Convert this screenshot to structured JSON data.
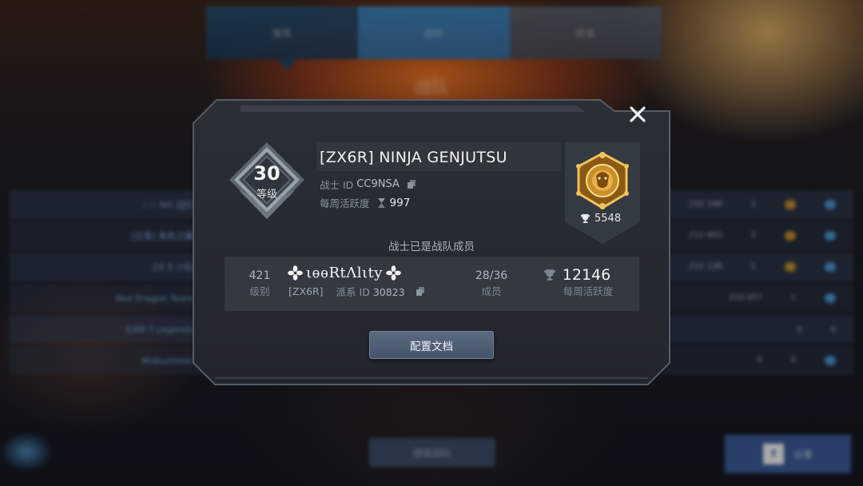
{
  "background": {
    "tabs": [
      "推荐",
      "组织",
      "好友"
    ],
    "heading": "战队",
    "rows": [
      {
        "name": "☆☆ NG 战队",
        "score": "232 168",
        "count": "1"
      },
      {
        "name": "[日落] 黑色之翼",
        "score": "212 902",
        "count": "2"
      },
      {
        "name": "ZX 9 小队",
        "score": "212 138",
        "count": "1"
      },
      {
        "name": "Red Dragon Team",
        "score": "210 457",
        "count": "1"
      },
      {
        "name": "EXM 7 Legends",
        "score": "0",
        "count": "0"
      },
      {
        "name": "Midsummer",
        "score": "0",
        "count": "0"
      }
    ],
    "bottom_button_label": "搜索战队",
    "fb_button_label": "分享"
  },
  "profile": {
    "rank": {
      "number": "30",
      "label": "等级"
    },
    "player_name": "[ZX6R] NINJA GENJUTSU",
    "player_id_label": "战士 ID",
    "player_id": "CC9NSA",
    "weekly_activity_label": "每周活跃度",
    "weekly_activity": "997",
    "trophy_score": "5548",
    "status": "战士已是战队成员"
  },
  "team": {
    "level_value": "421",
    "level_label": "级别",
    "name": "ιѳѳRtΛlιty",
    "tag": "[ZX6R]",
    "faction_id_label": "派系 ID",
    "faction_id": "30823",
    "members_value": "28/36",
    "members_label": "成员",
    "activity_value": "12146",
    "activity_label": "每周活跃度"
  },
  "actions": {
    "profile_button_label": "配置文档"
  },
  "colors": {
    "modal_bg": "#2a2f36",
    "accent_blue": "#3a8fd0",
    "emblem_gold": "#d9a441"
  },
  "icons": {
    "close": "close-icon",
    "copy": "copy-icon",
    "hourglass": "hourglass-icon",
    "trophy": "trophy-icon",
    "lion": "lion-emblem-icon",
    "flower": "flower-icon"
  }
}
